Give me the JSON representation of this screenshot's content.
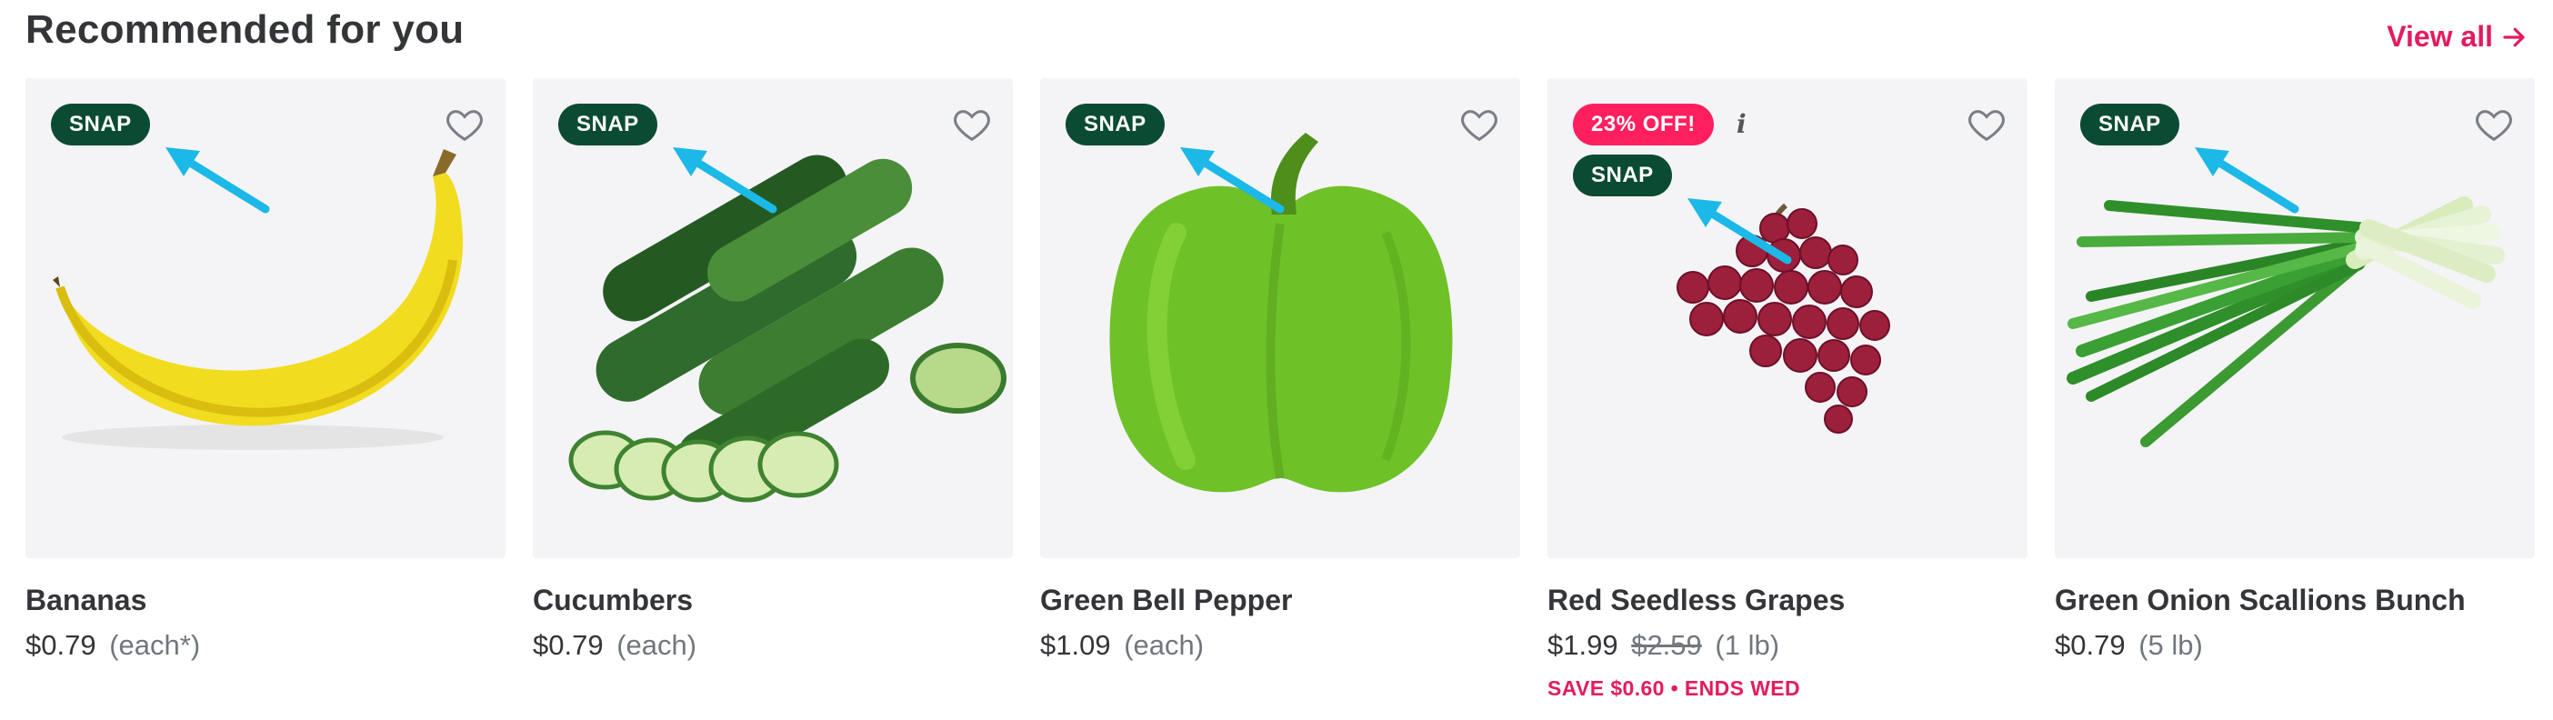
{
  "section": {
    "title": "Recommended for you",
    "view_all": "View all"
  },
  "colors": {
    "accent": "#e31c5f",
    "snap_badge": "#0b4b33",
    "discount_badge": "#ff1f5f",
    "annotation_arrow": "#1cb8e8"
  },
  "products": [
    {
      "name": "Bananas",
      "price": "$0.79",
      "unit": "(each*)",
      "badges": [
        "SNAP"
      ],
      "favorite_icon": "heart-outline-icon"
    },
    {
      "name": "Cucumbers",
      "price": "$0.79",
      "unit": "(each)",
      "badges": [
        "SNAP"
      ],
      "favorite_icon": "heart-outline-icon"
    },
    {
      "name": "Green Bell Pepper",
      "price": "$1.09",
      "unit": "(each)",
      "badges": [
        "SNAP"
      ],
      "favorite_icon": "heart-outline-icon"
    },
    {
      "name": "Red Seedless Grapes",
      "price": "$1.99",
      "original_price": "$2.59",
      "unit": "(1 lb)",
      "discount_badge": "23% OFF!",
      "info_icon": "i",
      "badges": [
        "SNAP"
      ],
      "promo": "SAVE $0.60 • ENDS WED",
      "favorite_icon": "heart-outline-icon"
    },
    {
      "name": "Green Onion Scallions Bunch",
      "price": "$0.79",
      "unit": "(5 lb)",
      "badges": [
        "SNAP"
      ],
      "favorite_icon": "heart-outline-icon"
    }
  ]
}
